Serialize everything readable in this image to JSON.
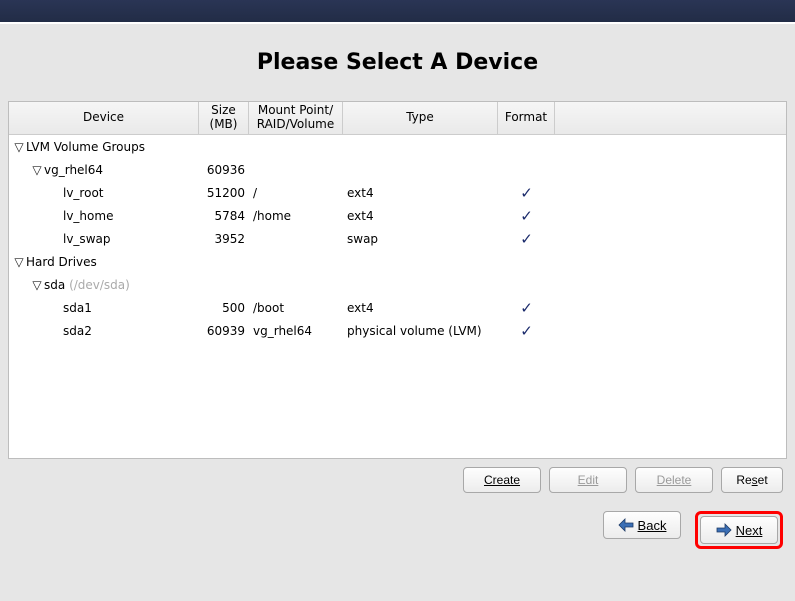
{
  "title": "Please Select A Device",
  "columns": {
    "device": "Device",
    "size": "Size (MB)",
    "mount": "Mount Point/ RAID/Volume",
    "type": "Type",
    "format": "Format"
  },
  "groups": {
    "lvm_label": "LVM Volume Groups",
    "hd_label": "Hard Drives"
  },
  "vg": {
    "name": "vg_rhel64",
    "size": "60936",
    "lvs": [
      {
        "name": "lv_root",
        "size": "51200",
        "mount": "/",
        "type": "ext4",
        "format": true
      },
      {
        "name": "lv_home",
        "size": "5784",
        "mount": "/home",
        "type": "ext4",
        "format": true
      },
      {
        "name": "lv_swap",
        "size": "3952",
        "mount": "",
        "type": "swap",
        "format": true
      }
    ]
  },
  "disk": {
    "name": "sda",
    "path": "(/dev/sda)",
    "parts": [
      {
        "name": "sda1",
        "size": "500",
        "mount": "/boot",
        "type": "ext4",
        "format": true
      },
      {
        "name": "sda2",
        "size": "60939",
        "mount": "vg_rhel64",
        "type": "physical volume (LVM)",
        "format": true
      }
    ]
  },
  "toolbar": {
    "create": "Create",
    "edit": "Edit",
    "delete": "Delete",
    "reset": "Reset"
  },
  "nav": {
    "back": "Back",
    "next": "Next"
  },
  "icons": {
    "check": "✓",
    "triangle_down": "▽"
  }
}
